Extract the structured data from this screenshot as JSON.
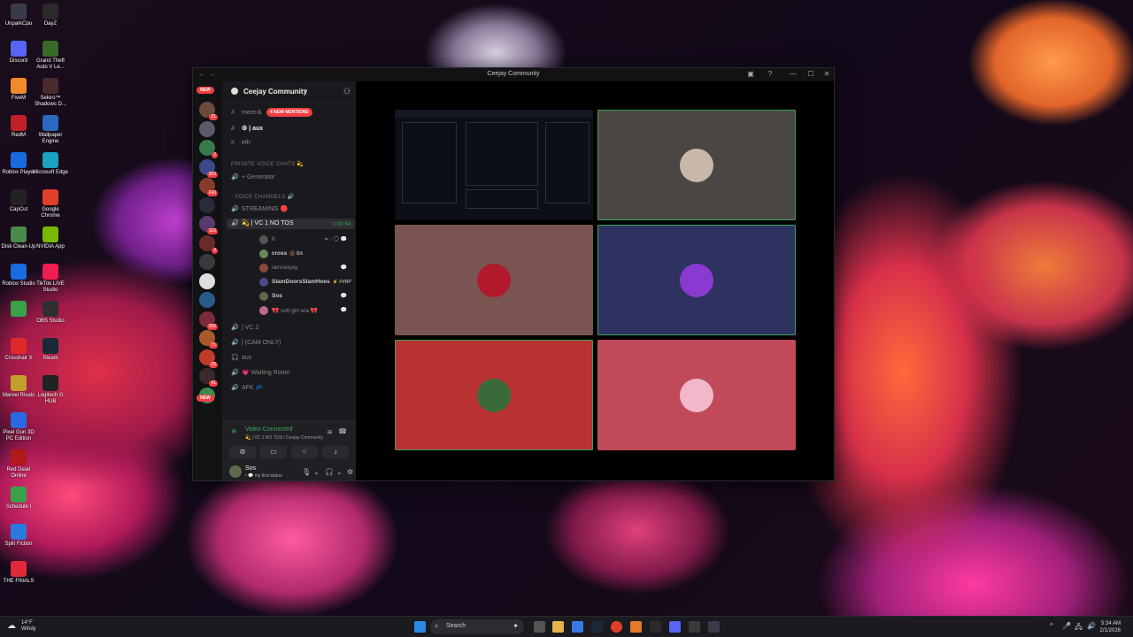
{
  "desktop": {
    "icons": [
      {
        "label": "UnparkCpu",
        "color": "#3a3a4a"
      },
      {
        "label": "DayZ",
        "color": "#2a2a2a"
      },
      {
        "label": "Discord",
        "color": "#5865f2"
      },
      {
        "label": "Grand Theft Auto V Le...",
        "color": "#3a6a2a"
      },
      {
        "label": "FiveM",
        "color": "#f08a2a"
      },
      {
        "label": "Sekiro™ Shadows D...",
        "color": "#4a2a2a"
      },
      {
        "label": "RedM",
        "color": "#c0202a"
      },
      {
        "label": "Wallpaper Engine",
        "color": "#2a6ac0"
      },
      {
        "label": "Roblox Player",
        "color": "#1a6ae0"
      },
      {
        "label": "Microsoft Edge",
        "color": "#1aa0c0"
      },
      {
        "label": "CapCut",
        "color": "#222222"
      },
      {
        "label": "Google Chrome",
        "color": "#e0402a"
      },
      {
        "label": "Disk Clean-Up",
        "color": "#4a8a4a"
      },
      {
        "label": "NVIDIA App",
        "color": "#76b900"
      },
      {
        "label": "Roblox Studio",
        "color": "#1a6ae0"
      },
      {
        "label": "TikTok LIVE Studio",
        "color": "#ee1d52"
      },
      {
        "label": "",
        "color": "#3aa04a"
      },
      {
        "label": "OBS Studio",
        "color": "#302e31"
      },
      {
        "label": "Crosshair X",
        "color": "#e02a2a"
      },
      {
        "label": "Steam",
        "color": "#1b2838"
      },
      {
        "label": "Marvel Rivals",
        "color": "#c0a02a"
      },
      {
        "label": "Logitech G HUB",
        "color": "#222222"
      },
      {
        "label": "Pixel Gun 3D PC Edition",
        "color": "#2a6ae0"
      },
      {
        "label": "",
        "color": "transparent"
      },
      {
        "label": "Red Dead Online",
        "color": "#b01a1a"
      },
      {
        "label": "",
        "color": "transparent"
      },
      {
        "label": "Schedule I",
        "color": "#3aa04a"
      },
      {
        "label": "",
        "color": "transparent"
      },
      {
        "label": "Split Fiction",
        "color": "#2a7ae0"
      },
      {
        "label": "",
        "color": "transparent"
      },
      {
        "label": "THE FINALS",
        "color": "#e02a3a"
      }
    ]
  },
  "window": {
    "title": "Ceejay Community",
    "back": "←",
    "forward": "→",
    "minimize": "—",
    "maximize": "☐",
    "close": "✕",
    "inbox_icon": "inbox-icon",
    "help": "?"
  },
  "servers": {
    "new_top": "NEW",
    "new_bottom": "NEW",
    "items": [
      {
        "color": "#6a4a3a",
        "badge": "21"
      },
      {
        "color": "#5a5a6a",
        "badge": ""
      },
      {
        "color": "#3a7a4a",
        "badge": "2"
      },
      {
        "color": "#3a4a8a",
        "badge": "303"
      },
      {
        "color": "#8a3a2a",
        "badge": "243"
      },
      {
        "color": "#2a2a3a",
        "badge": ""
      },
      {
        "color": "#5a3a6a",
        "badge": "110"
      },
      {
        "color": "#6a2a2a",
        "badge": "2"
      },
      {
        "color": "#3a3a3a",
        "badge": ""
      },
      {
        "color": "#ddd",
        "badge": ""
      },
      {
        "color": "#2a5a8a",
        "badge": ""
      },
      {
        "color": "#7a2a3a",
        "badge": "256"
      },
      {
        "color": "#aa5a2a",
        "badge": "71"
      },
      {
        "color": "#c03a2a",
        "badge": "29"
      },
      {
        "color": "#3a2a2a",
        "badge": "41"
      },
      {
        "color": "#3a8a4a",
        "badge": ""
      }
    ]
  },
  "guild": {
    "name": "Ceejay Community",
    "chevron": "⌄",
    "mentions": "4 NEW MENTIONS",
    "text_channels": [
      {
        "prefix": "#",
        "name": "meet-&"
      },
      {
        "prefix": "#",
        "name": "⚙ | aux"
      },
      {
        "prefix": "#",
        "name": "eth"
      }
    ],
    "cat_private": "PRIVATE VOICE CHATS 💫",
    "generator": "Generator",
    "cat_voice": "- VOICE CHANNELS 🔊",
    "streaming": "STREAMING 🔴",
    "active_channel": "💫 | VC 1 NO TOS",
    "timer": "1:00:54",
    "first_user": "8",
    "users": [
      {
        "name": "cross",
        "tag": "🛞 BA",
        "color": "#6a8a5a",
        "dim": false
      },
      {
        "name": "iamceejay.",
        "tag": "",
        "color": "#8a4a3a",
        "dim": true
      },
      {
        "name": "SlamDoorsSlamHoes",
        "tag": "⚡ FVRP",
        "color": "#4a4a8a",
        "dim": false
      },
      {
        "name": "Sos",
        "tag": "",
        "color": "#5a6a4a",
        "dim": false
      },
      {
        "name": "🎀 soft girl era 🎀",
        "tag": "",
        "color": "#c06a8a",
        "dim": true
      }
    ],
    "voice_channels": [
      {
        "name": "| VC 2"
      },
      {
        "name": "| (CAM ONLY)"
      },
      {
        "name": "aux"
      },
      {
        "name": "💗 Waiting Room"
      },
      {
        "name": "AFK 💤"
      }
    ]
  },
  "voice_panel": {
    "status": "Video Connected",
    "sub": "💫 | VC 1 NO TOS / Ceejay Community",
    "buttons": [
      "camera-off-icon",
      "screen-share-icon",
      "activities-icon",
      "soundboard-icon"
    ]
  },
  "user_panel": {
    "name": "Sos",
    "status": "• 💬 my first status"
  },
  "stage": {
    "tiles": [
      {
        "type": "screenshare",
        "bg": "#0d0f16",
        "face": "",
        "speaking": false
      },
      {
        "type": "camera",
        "bg": "#4a4644",
        "face": "#c8b8a8",
        "speaking": true
      },
      {
        "type": "camera",
        "bg": "#7a5450",
        "face": "#b01a2a",
        "speaking": false
      },
      {
        "type": "camera",
        "bg": "#2e3260",
        "face": "#8a3ad0",
        "speaking": true
      },
      {
        "type": "camera",
        "bg": "#b83232",
        "face": "#3a6a3a",
        "speaking": true
      },
      {
        "type": "camera",
        "bg": "#c04a5a",
        "face": "#f0b8c8",
        "speaking": false
      }
    ]
  },
  "taskbar": {
    "weather_temp": "14°F",
    "weather_desc": "Windy",
    "search": "Search",
    "time": "5:34 AM",
    "date": "2/1/2026",
    "tray": [
      "^",
      "🎤",
      "🖧",
      "🔊",
      "🔋"
    ]
  }
}
